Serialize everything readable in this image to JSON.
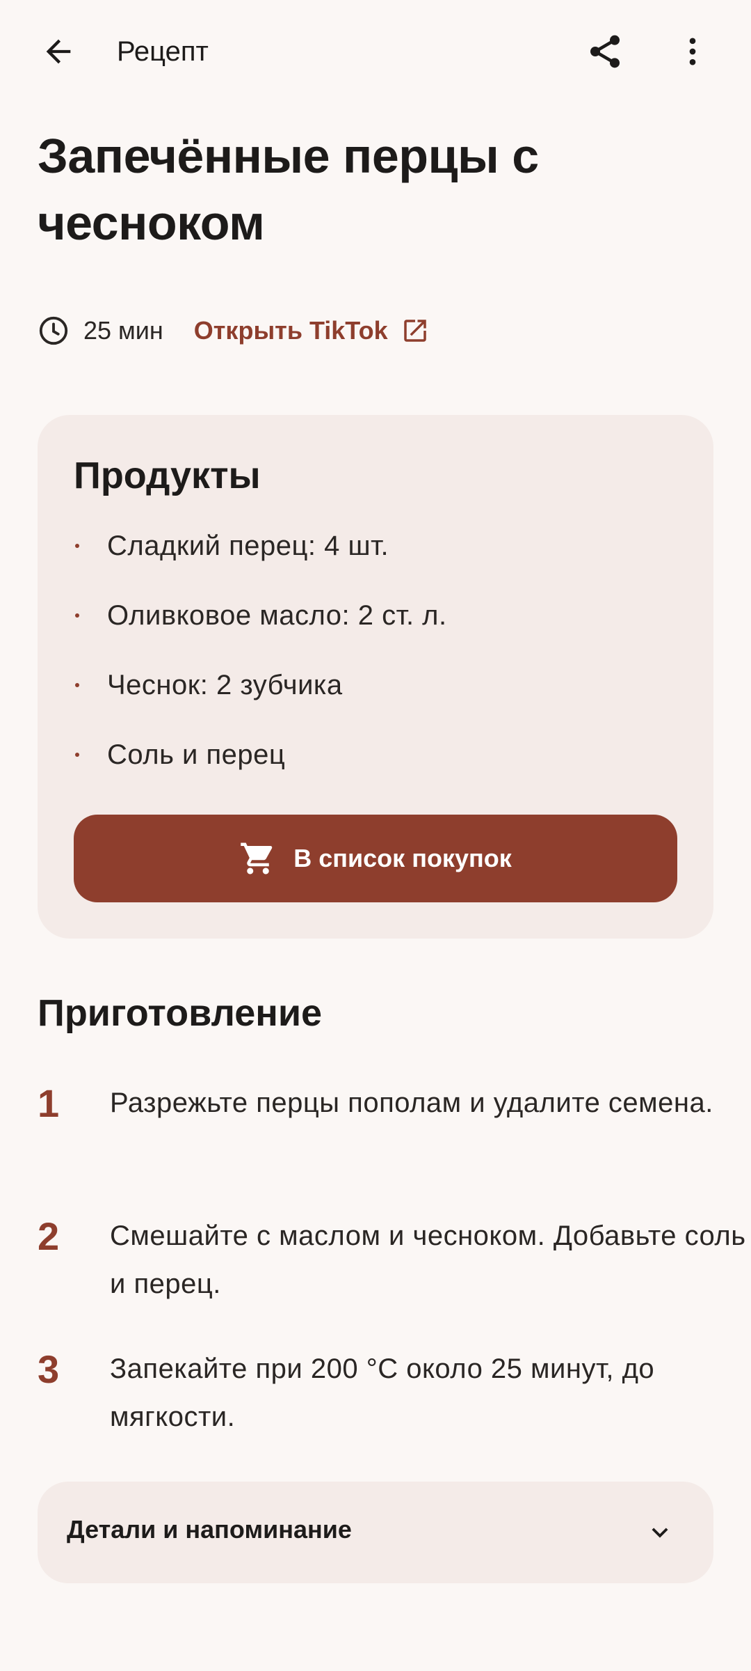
{
  "topbar": {
    "title": "Рецепт",
    "back_icon": "arrow-left-icon",
    "share_icon": "share-icon",
    "more_icon": "more-vert-icon"
  },
  "recipe": {
    "title": "Запечённые перцы с чесноком",
    "time": "25 мин",
    "time_icon": "clock-icon",
    "source_link": "Открыть TikTok",
    "source_icon": "open-in-new-icon"
  },
  "ingredients": {
    "title": "Продукты",
    "items": [
      "Сладкий перец: 4 шт.",
      "Оливковое масло: 2 ст. л.",
      "Чеснок: 2 зубчика",
      "Соль и перец"
    ],
    "button_label": "В список покупок",
    "button_icon": "shopping-cart-icon"
  },
  "steps": {
    "title": "Приготовление",
    "items": [
      {
        "num": "1",
        "text": "Разрежьте перцы пополам и удалите семена."
      },
      {
        "num": "2",
        "text": "Смешайте с маслом и чесноком. Добавьте соль и перец."
      },
      {
        "num": "3",
        "text": "Запекайте при 200 °С около 25 минут, до мягкости."
      }
    ]
  },
  "details": {
    "label": "Детали и напоминание",
    "icon": "chevron-down-icon"
  },
  "colors": {
    "background": "#fbf7f5",
    "accent": "#8e3e2d",
    "card": "#f4ebe8",
    "text": "#1d1b1a"
  }
}
